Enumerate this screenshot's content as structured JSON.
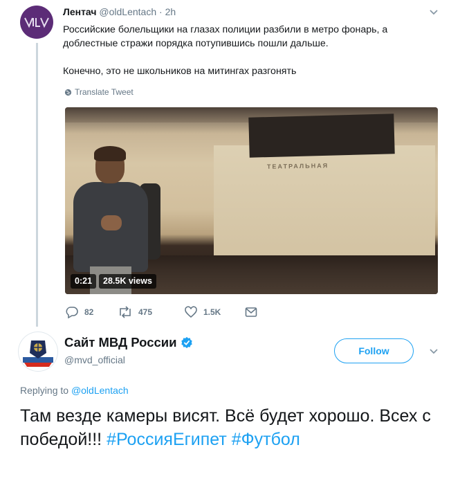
{
  "tweet1": {
    "name": "Лентач",
    "handle": "@oldLentach",
    "dot": "·",
    "time": "2h",
    "text_line1": "Российские болельщики на глазах полиции разбили в метро фонарь, а доблестные стражи порядка потупившись пошли дальше.",
    "text_line2": "Конечно, это не школьников на митингах разгонять",
    "translate_label": "Translate Tweet",
    "video": {
      "duration": "0:21",
      "views": "28.5K views",
      "station_sign": "ТЕАТРАЛЬНАЯ"
    },
    "actions": {
      "replies": "82",
      "retweets": "475",
      "likes": "1.5K"
    }
  },
  "tweet2": {
    "name": "Сайт МВД России",
    "handle": "@mvd_official",
    "follow_label": "Follow",
    "replying_prefix": "Replying to",
    "replying_to": "@oldLentach",
    "text_plain": "Там везде камеры висят. Всё будет хорошо. Всех с победой!!! ",
    "hashtag1": "#РоссияЕгипет",
    "hashtag2": "#Футбол"
  },
  "colors": {
    "accent": "#1da1f2",
    "secondary_text": "#657786",
    "primary_text": "#14171a",
    "avatar1_bg": "#5c2c77"
  },
  "icons": [
    "chevron-down-icon",
    "globe-icon",
    "reply-icon",
    "retweet-icon",
    "like-icon",
    "message-icon",
    "verified-icon"
  ]
}
